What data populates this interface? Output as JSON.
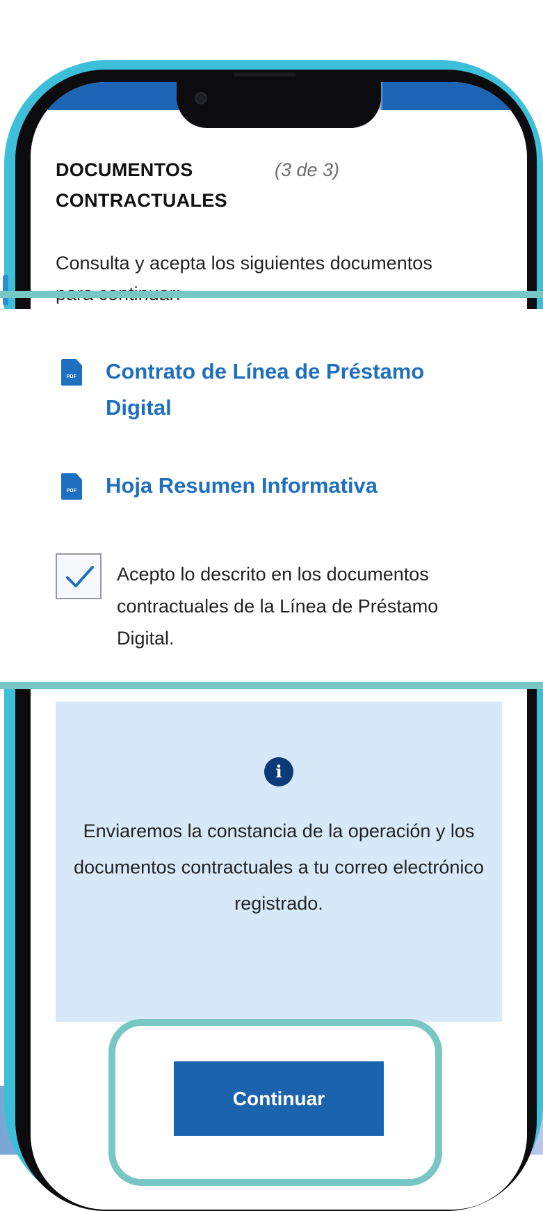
{
  "section": {
    "title": "DOCUMENTOS CONTRACTUALES",
    "step": "(3 de 3)",
    "intro": "Consulta y acepta los siguientes documentos para continuar:"
  },
  "documents": [
    {
      "label": "Contrato de Línea de Préstamo Digital",
      "icon": "pdf-icon",
      "icon_text": "PDF"
    },
    {
      "label": "Hoja Resumen Informativa",
      "icon": "pdf-icon",
      "icon_text": "PDF"
    }
  ],
  "acceptance": {
    "checked": true,
    "label": "Acepto lo descrito en los documentos contractuales de la Línea de Préstamo Digital."
  },
  "info": {
    "icon": "info-icon",
    "icon_glyph": "i",
    "text": "Enviaremos la constancia de la operación y los documentos contractuales a tu correo electrónico registrado."
  },
  "actions": {
    "continue_label": "Continuar"
  },
  "colors": {
    "link": "#1f6fc0",
    "button": "#1c63ae",
    "info_bg": "#d7e9f8",
    "highlight": "#79c7c4",
    "phone_frame": "#3ebfd9"
  }
}
